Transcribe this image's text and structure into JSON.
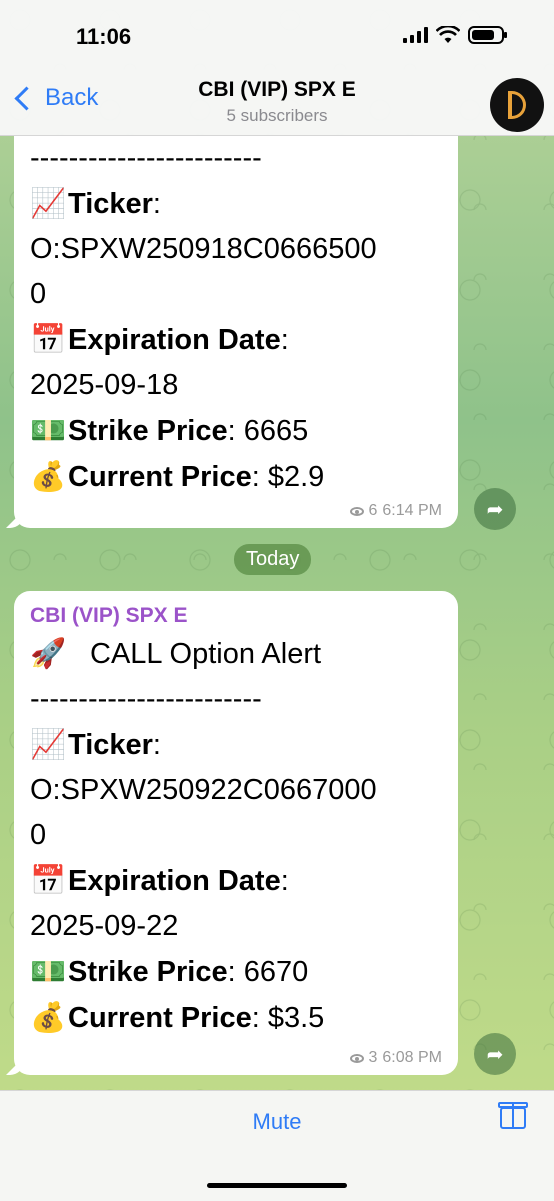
{
  "status_bar": {
    "time": "11:06"
  },
  "header": {
    "back_label": "Back",
    "title": "CBI (VIP) SPX E",
    "subtitle": "5 subscribers"
  },
  "messages": [
    {
      "dashes": "------------------------",
      "ticker_label": "Ticker",
      "ticker_value": "O:SPXW250918C0666500",
      "ticker_value_cont": "0",
      "exp_label": "Expiration Date",
      "exp_value": "2025-09-18",
      "strike_label": "Strike Price",
      "strike_value": "6665",
      "current_label": "Current Price",
      "current_value": "$2.9",
      "views": "6",
      "time": "6:14 PM"
    },
    {
      "sender": "CBI (VIP) SPX E",
      "alert": "CALL Option Alert",
      "dashes": "------------------------",
      "ticker_label": "Ticker",
      "ticker_value": "O:SPXW250922C0667000",
      "ticker_value_cont": "0",
      "exp_label": "Expiration Date",
      "exp_value": "2025-09-22",
      "strike_label": "Strike Price",
      "strike_value": "6670",
      "current_label": "Current Price",
      "current_value": "$3.5",
      "views": "3",
      "time": "6:08 PM"
    }
  ],
  "date_separator": "Today",
  "emoji": {
    "chart": "📈",
    "calendar": "📅",
    "money": "💵",
    "bag": "💰",
    "rocket": "🚀"
  },
  "bottom_bar": {
    "mute_label": "Mute"
  }
}
